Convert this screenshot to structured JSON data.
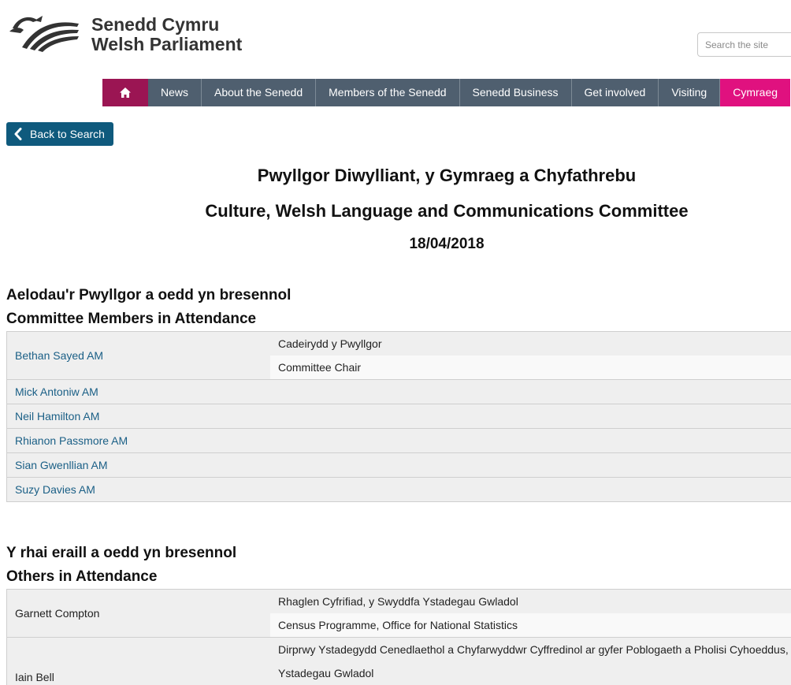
{
  "header": {
    "logo_line1": "Senedd Cymru",
    "logo_line2": "Welsh Parliament",
    "search_placeholder": "Search the site"
  },
  "nav": {
    "items": [
      "News",
      "About the Senedd",
      "Members of the Senedd",
      "Senedd Business",
      "Get involved",
      "Visiting"
    ],
    "language_link": "Cymraeg"
  },
  "back_button": "Back to Search",
  "meeting": {
    "title_cy": "Pwyllgor Diwylliant, y Gymraeg a Chyfathrebu",
    "title_en": "Culture, Welsh Language and Communications Committee",
    "date": "18/04/2018"
  },
  "members_section": {
    "heading_cy": "Aelodau'r Pwyllgor a oedd yn bresennol",
    "heading_en": "Committee Members in Attendance",
    "members": [
      {
        "name": "Bethan Sayed AM",
        "role_cy": "Cadeirydd y Pwyllgor",
        "role_en": "Committee Chair"
      },
      {
        "name": "Mick Antoniw AM"
      },
      {
        "name": "Neil Hamilton AM"
      },
      {
        "name": "Rhianon Passmore AM"
      },
      {
        "name": "Sian Gwenllian AM"
      },
      {
        "name": "Suzy Davies AM"
      }
    ]
  },
  "others_section": {
    "heading_cy": "Y rhai eraill a oedd yn bresennol",
    "heading_en": "Others in Attendance",
    "others": [
      {
        "name": "Garnett Compton",
        "role_cy": "Rhaglen Cyfrifiad, y Swyddfa Ystadegau Gwladol",
        "role_en": "Census Programme, Office for National Statistics"
      },
      {
        "name": "Iain Bell",
        "role_cy": "Dirprwy Ystadegydd Cenedlaethol a Chyfarwyddwr Cyffredinol ar gyfer Poblogaeth a Pholisi Cyhoeddus,",
        "role_cy_2": "Ystadegau Gwladol"
      }
    ]
  },
  "colors": {
    "nav_bg": "#4f5f6f",
    "home_bg": "#9b1553",
    "cymraeg_bg": "#e0117f",
    "back_button_bg": "#0f5a7d",
    "link": "#1a5f86"
  }
}
